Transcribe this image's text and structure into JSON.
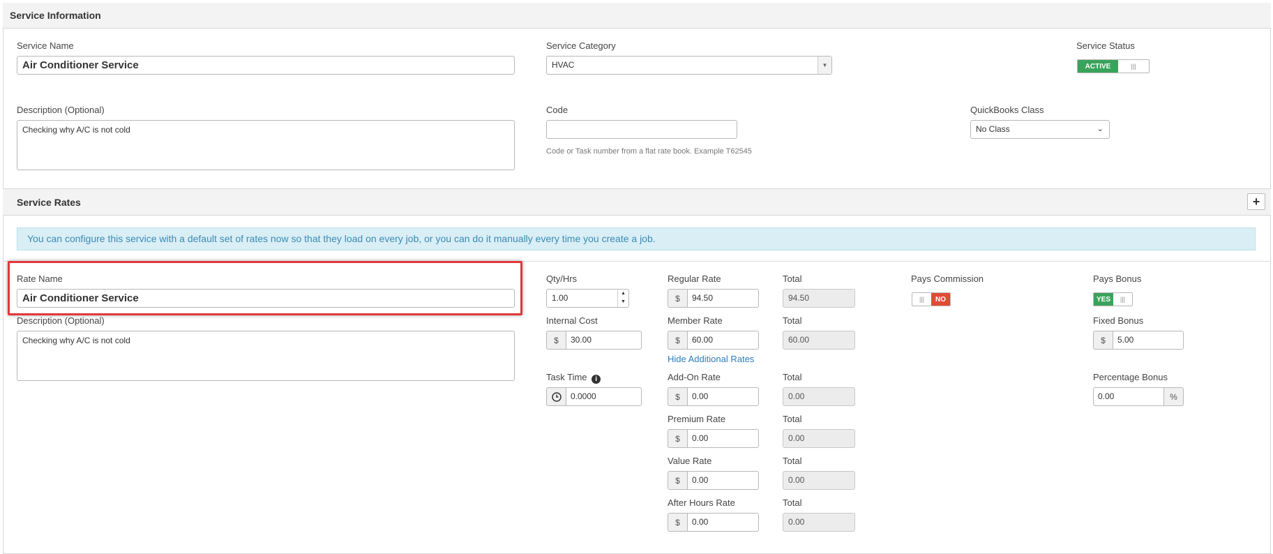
{
  "service_info": {
    "header": "Service Information",
    "service_name_label": "Service Name",
    "service_name_value": "Air Conditioner Service",
    "category_label": "Service Category",
    "category_value": "HVAC",
    "status_label": "Service Status",
    "status_on_text": "ACTIVE",
    "description_label": "Description (Optional)",
    "description_value": "Checking why A/C is not cold",
    "code_label": "Code",
    "code_value": "",
    "code_help": "Code or Task number from a flat rate book. Example T62545",
    "qb_label": "QuickBooks Class",
    "qb_value": "No Class"
  },
  "service_rates": {
    "header": "Service Rates",
    "add_icon": "plus-icon",
    "banner": "You can configure this service with a default set of rates now so that they load on every job, or you can do it manually every time you create a job.",
    "rate_name_label": "Rate Name",
    "rate_name_value": "Air Conditioner Service",
    "description_label": "Description (Optional)",
    "description_value": "Checking why A/C is not cold",
    "qty_label": "Qty/Hrs",
    "qty_value": "1.00",
    "internal_cost_label": "Internal Cost",
    "internal_cost_value": "30.00",
    "task_time_label": "Task Time",
    "task_time_value": "0.0000",
    "currency": "$",
    "percent": "%",
    "total_label": "Total",
    "hide_rates_link": "Hide Additional Rates",
    "rates": [
      {
        "label": "Regular Rate",
        "value": "94.50",
        "total": "94.50"
      },
      {
        "label": "Member Rate",
        "value": "60.00",
        "total": "60.00"
      },
      {
        "label": "Add-On Rate",
        "value": "0.00",
        "total": "0.00"
      },
      {
        "label": "Premium Rate",
        "value": "0.00",
        "total": "0.00"
      },
      {
        "label": "Value Rate",
        "value": "0.00",
        "total": "0.00"
      },
      {
        "label": "After Hours Rate",
        "value": "0.00",
        "total": "0.00"
      }
    ],
    "pays_commission_label": "Pays Commission",
    "pays_commission_text": "NO",
    "pays_bonus_label": "Pays Bonus",
    "pays_bonus_text": "YES",
    "fixed_bonus_label": "Fixed Bonus",
    "fixed_bonus_value": "5.00",
    "percentage_bonus_label": "Percentage Bonus",
    "percentage_bonus_value": "0.00"
  },
  "colors": {
    "active_green": "#3aa35b",
    "no_red": "#e04b34",
    "highlight_red": "#e0383c",
    "banner_bg": "#d9eef5",
    "link_blue": "#2a7fc0"
  }
}
